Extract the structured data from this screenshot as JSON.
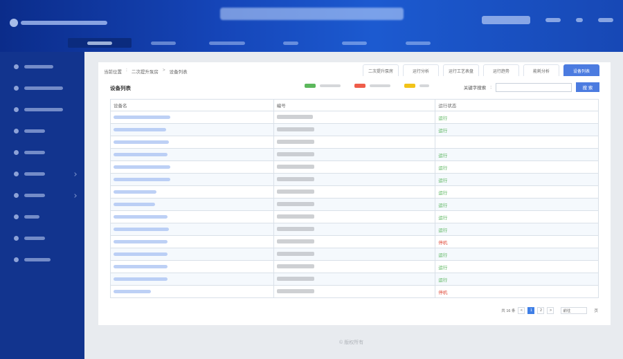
{
  "breadcrumb": {
    "label": "当前位置",
    "items": [
      "二次提升泵房",
      "设备列表"
    ]
  },
  "tabs": [
    {
      "label": "二次提升泵房",
      "active": false
    },
    {
      "label": "运行分析",
      "active": false
    },
    {
      "label": "运行工艺表盘",
      "active": false
    },
    {
      "label": "运行趋势",
      "active": false
    },
    {
      "label": "能耗分析",
      "active": false
    },
    {
      "label": "设备列表",
      "active": true
    }
  ],
  "list_title": "设备列表",
  "legend_colors": [
    "#5cb85c",
    "#ef5d4a",
    "#f2c318"
  ],
  "search": {
    "label": "关键字搜索",
    "value": "",
    "button": "搜 索"
  },
  "table": {
    "headers": [
      "设备名",
      "编号",
      "运行状态"
    ],
    "rows": [
      {
        "status": "运行",
        "status_type": "run"
      },
      {
        "status": "运行",
        "status_type": "run"
      },
      {
        "status": "",
        "status_type": ""
      },
      {
        "status": "运行",
        "status_type": "run"
      },
      {
        "status": "运行",
        "status_type": "run"
      },
      {
        "status": "运行",
        "status_type": "run"
      },
      {
        "status": "运行",
        "status_type": "run"
      },
      {
        "status": "运行",
        "status_type": "run"
      },
      {
        "status": "运行",
        "status_type": "run"
      },
      {
        "status": "运行",
        "status_type": "run"
      },
      {
        "status": "停机",
        "status_type": "stop"
      },
      {
        "status": "运行",
        "status_type": "run"
      },
      {
        "status": "运行",
        "status_type": "run"
      },
      {
        "status": "运行",
        "status_type": "run"
      },
      {
        "status": "停机",
        "status_type": "stop"
      }
    ]
  },
  "pager": {
    "total": "共 16 条",
    "prev": "<",
    "pages": [
      "1",
      "2"
    ],
    "current": "1",
    "next": ">",
    "jump_label": "前往",
    "page_suffix": "页"
  },
  "footer": "© 版权所有"
}
